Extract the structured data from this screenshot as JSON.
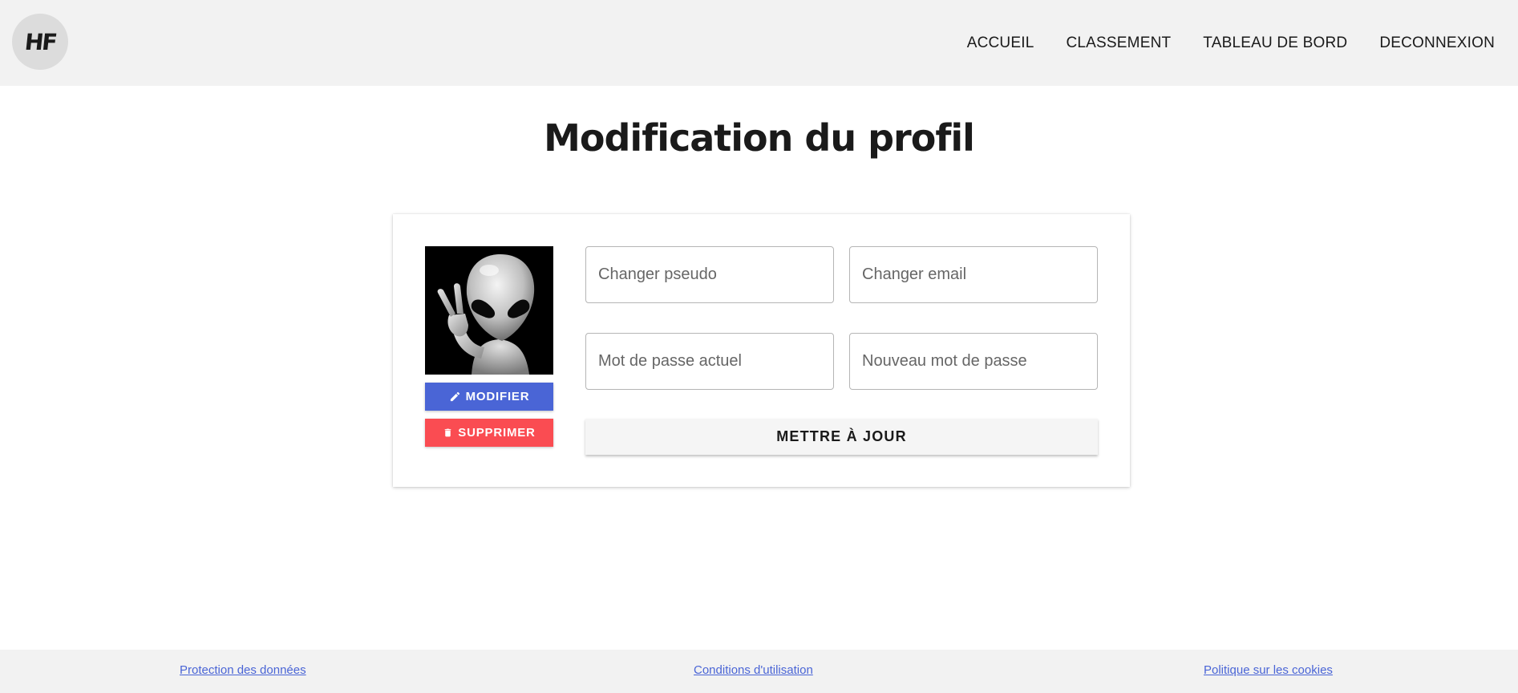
{
  "header": {
    "logo_text": "HF",
    "nav": {
      "home": "ACCUEIL",
      "ranking": "CLASSEMENT",
      "dashboard": "TABLEAU DE BORD",
      "logout": "DECONNEXION"
    }
  },
  "page": {
    "title": "Modification du profil"
  },
  "profile_card": {
    "avatar_icon": "alien-avatar",
    "modify_label": "MODIFIER",
    "delete_label": "SUPPRIMER",
    "pseudo_placeholder": "Changer pseudo",
    "email_placeholder": "Changer email",
    "current_password_placeholder": "Mot de passe actuel",
    "new_password_placeholder": "Nouveau mot de passe",
    "update_label": "METTRE À JOUR"
  },
  "footer": {
    "privacy": "Protection des données",
    "terms": "Conditions d'utilisation",
    "cookies": "Politique sur les cookies"
  },
  "colors": {
    "header_bg": "#f2f2f2",
    "modify_button": "#4a65d6",
    "delete_button": "#fa4c52",
    "link": "#4a65d6"
  }
}
